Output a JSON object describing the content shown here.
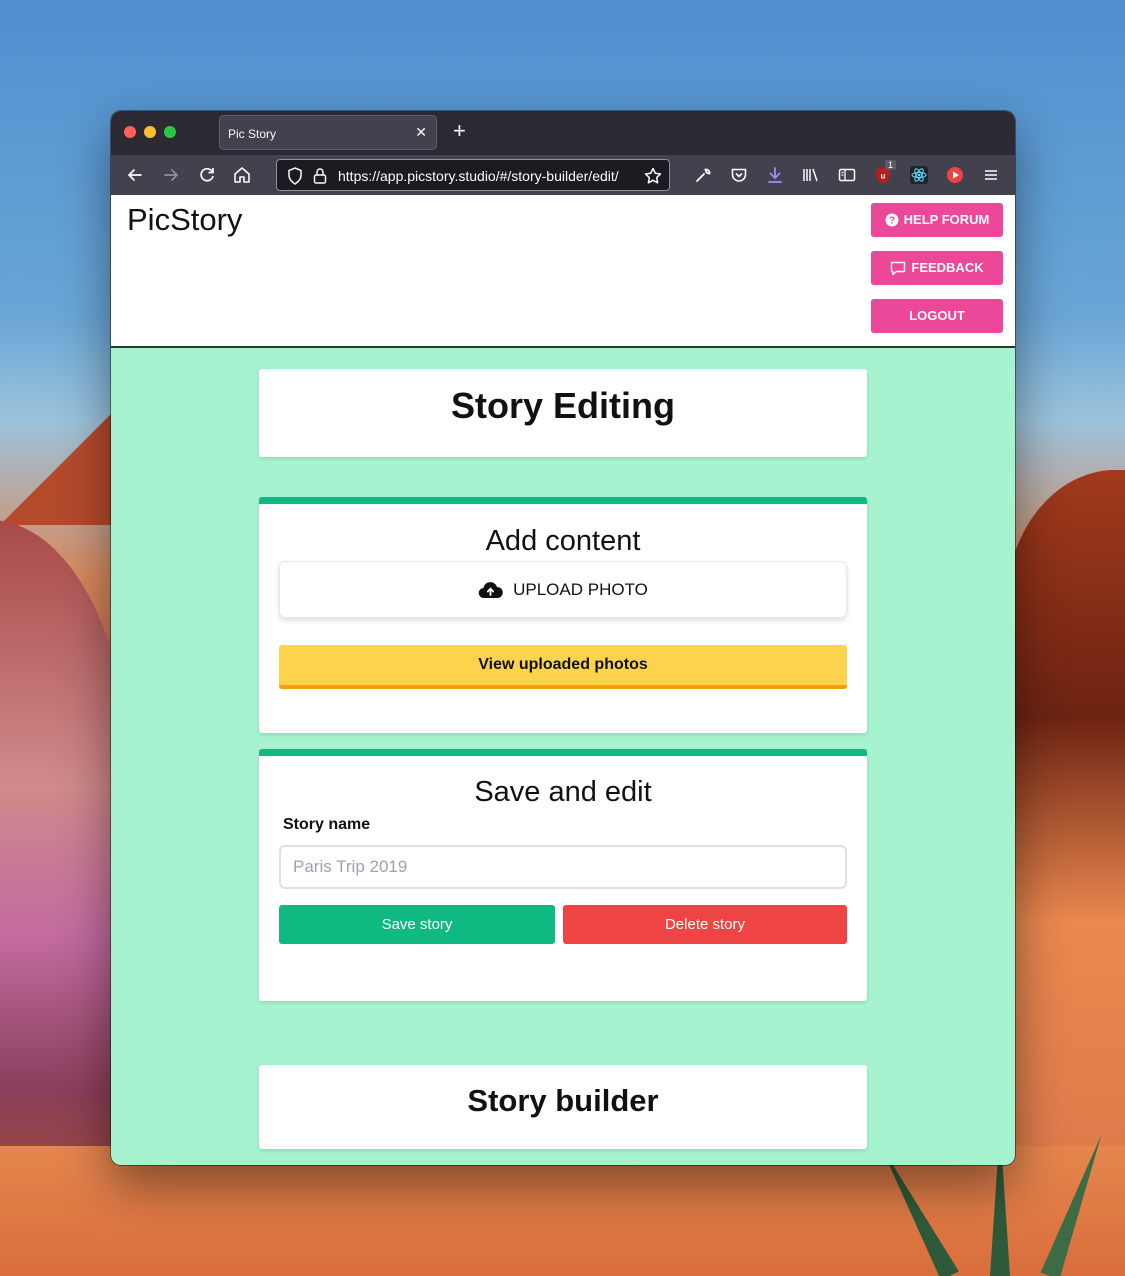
{
  "browser": {
    "tab_title": "Pic Story",
    "url": "https://app.picstory.studio/#/story-builder/edit/",
    "extension_badge": "1"
  },
  "header": {
    "logo": "PicStory",
    "help_forum_label": "HELP FORUM",
    "feedback_label": "FEEDBACK",
    "logout_label": "LOGOUT"
  },
  "editing": {
    "title": "Story Editing"
  },
  "add_content": {
    "title": "Add content",
    "upload_label": "UPLOAD PHOTO",
    "view_label": "View uploaded photos"
  },
  "save_edit": {
    "title": "Save and edit",
    "name_label": "Story name",
    "name_placeholder": "Paris Trip 2019",
    "save_label": "Save story",
    "delete_label": "Delete story"
  },
  "builder": {
    "title": "Story builder"
  },
  "colors": {
    "accent_pink": "#ec4899",
    "page_bg": "#a7f3d0",
    "card_border_green": "#10b981",
    "view_btn_yellow": "#fcd34d",
    "delete_red": "#ef4444"
  }
}
